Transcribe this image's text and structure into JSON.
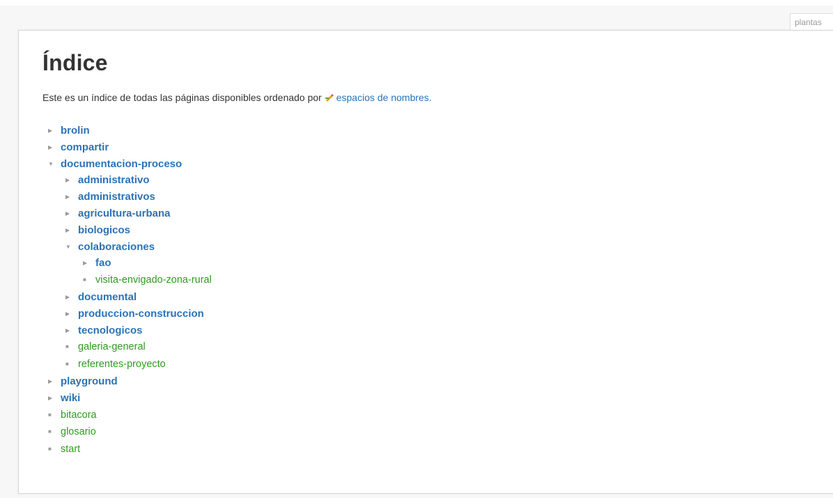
{
  "page_tab": "plantas",
  "title": "Índice",
  "intro": {
    "text": "Este es un índice de todas las páginas disponibles ordenado por",
    "link_label": "espacios de nombres."
  },
  "tree": [
    {
      "label": "brolin",
      "type": "namespace",
      "state": "closed"
    },
    {
      "label": "compartir",
      "type": "namespace",
      "state": "closed"
    },
    {
      "label": "documentacion-proceso",
      "type": "namespace",
      "state": "open",
      "children": [
        {
          "label": "administrativo",
          "type": "namespace",
          "state": "closed"
        },
        {
          "label": "administrativos",
          "type": "namespace",
          "state": "closed"
        },
        {
          "label": "agricultura-urbana",
          "type": "namespace",
          "state": "closed"
        },
        {
          "label": "biologicos",
          "type": "namespace",
          "state": "closed"
        },
        {
          "label": "colaboraciones",
          "type": "namespace",
          "state": "open",
          "children": [
            {
              "label": "fao",
              "type": "namespace",
              "state": "closed"
            },
            {
              "label": "visita-envigado-zona-rural",
              "type": "page"
            }
          ]
        },
        {
          "label": "documental",
          "type": "namespace",
          "state": "closed"
        },
        {
          "label": "produccion-construccion",
          "type": "namespace",
          "state": "closed"
        },
        {
          "label": "tecnologicos",
          "type": "namespace",
          "state": "closed"
        },
        {
          "label": "galeria-general",
          "type": "page"
        },
        {
          "label": "referentes-proyecto",
          "type": "page"
        }
      ]
    },
    {
      "label": "playground",
      "type": "namespace",
      "state": "closed"
    },
    {
      "label": "wiki",
      "type": "namespace",
      "state": "closed"
    },
    {
      "label": "bitacora",
      "type": "page"
    },
    {
      "label": "glosario",
      "type": "page"
    },
    {
      "label": "start",
      "type": "page"
    }
  ],
  "colors": {
    "namespace_link": "#2b73b7",
    "page_link": "#2e9b1f",
    "text": "#333333"
  }
}
